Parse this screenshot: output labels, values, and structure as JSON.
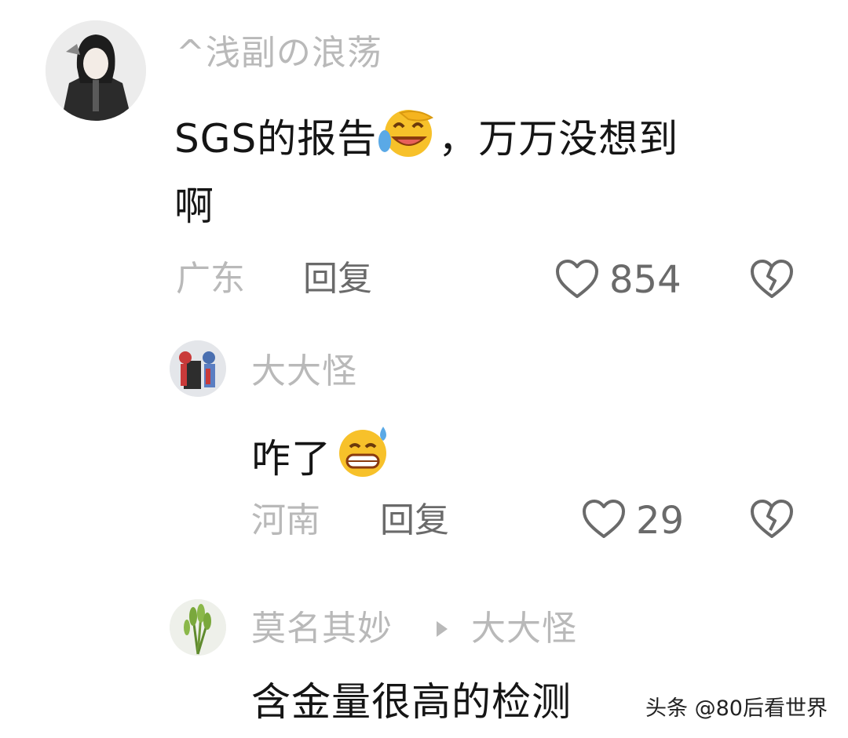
{
  "comments": [
    {
      "username": "^浅副の浪荡",
      "text_line1": "SGS的报告",
      "text_line1_after": "，万万没想到",
      "text_line2": "啊",
      "emoji": "rolling-laughing-emoji",
      "location": "广东",
      "reply_label": "回复",
      "likes": "854"
    },
    {
      "username": "大大怪",
      "text": "咋了",
      "emoji": "grinning-sweat-emoji",
      "location": "河南",
      "reply_label": "回复",
      "likes": "29"
    },
    {
      "username": "莫名其妙",
      "reply_to": "大大怪",
      "text": "含金量很高的检测"
    }
  ],
  "watermark": "头条 @80后看世界",
  "colors": {
    "meta_gray": "#b9b9b9",
    "action_gray": "#6a6a6a",
    "text_black": "#151515"
  }
}
